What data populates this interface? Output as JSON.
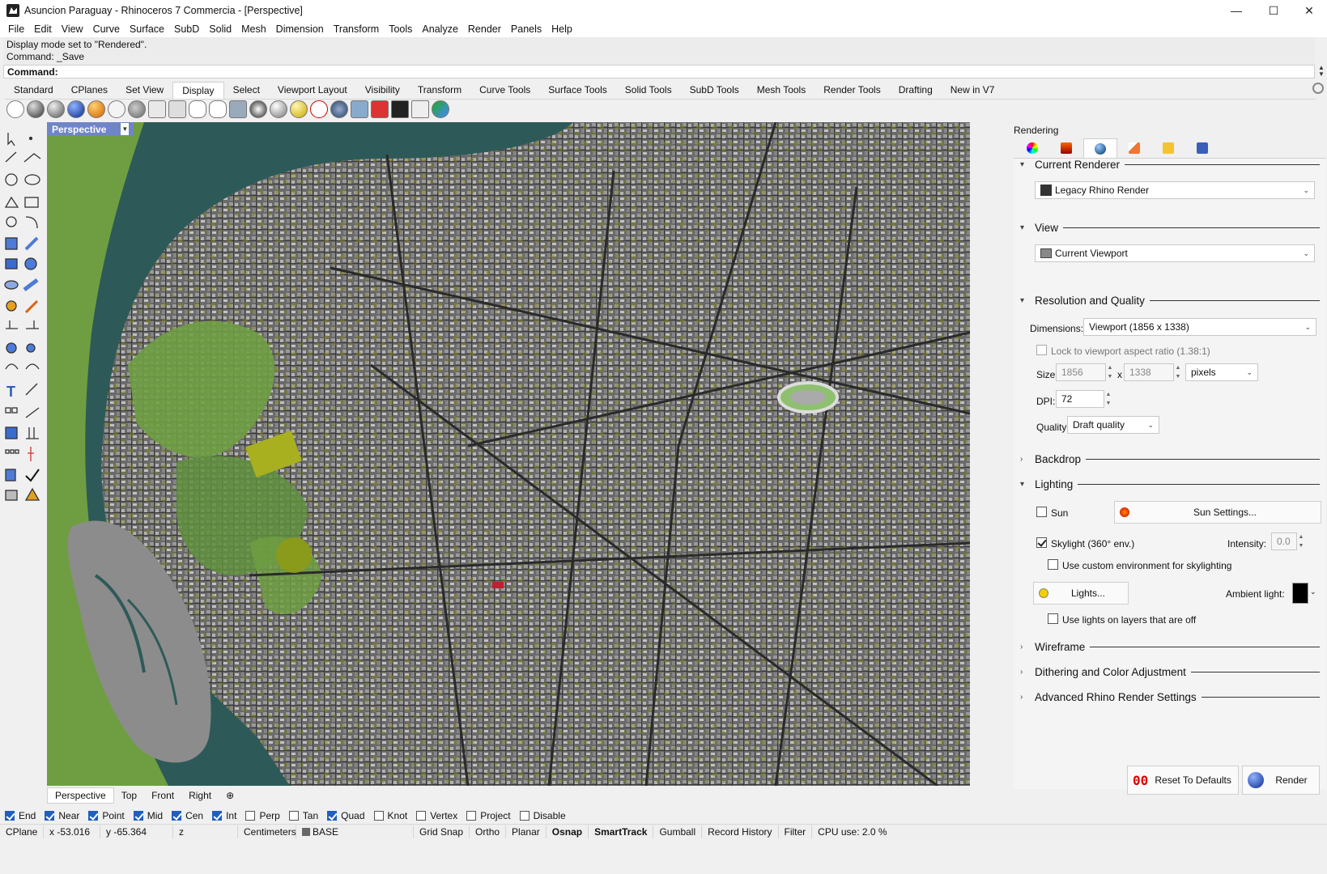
{
  "window": {
    "title": "Asuncion Paraguay - Rhinoceros 7 Commercia - [Perspective]",
    "minimize": "—",
    "maximize": "☐",
    "close": "✕"
  },
  "menu": [
    "File",
    "Edit",
    "View",
    "Curve",
    "Surface",
    "SubD",
    "Solid",
    "Mesh",
    "Dimension",
    "Transform",
    "Tools",
    "Analyze",
    "Render",
    "Panels",
    "Help"
  ],
  "command": {
    "history_1": "Display mode set to \"Rendered\".",
    "history_2": "Command: _Save",
    "prompt": "Command:"
  },
  "toolbar_tabs": [
    "Standard",
    "CPlanes",
    "Set View",
    "Display",
    "Select",
    "Viewport Layout",
    "Visibility",
    "Transform",
    "Curve Tools",
    "Surface Tools",
    "Solid Tools",
    "SubD Tools",
    "Mesh Tools",
    "Render Tools",
    "Drafting",
    "New in V7"
  ],
  "active_toolbar_tab": "Display",
  "viewport": {
    "name": "Perspective",
    "tabs": [
      "Perspective",
      "Top",
      "Front",
      "Right"
    ],
    "add_tab": "⊕"
  },
  "osnaps": [
    {
      "label": "End",
      "checked": true
    },
    {
      "label": "Near",
      "checked": true
    },
    {
      "label": "Point",
      "checked": true
    },
    {
      "label": "Mid",
      "checked": true
    },
    {
      "label": "Cen",
      "checked": true
    },
    {
      "label": "Int",
      "checked": true
    },
    {
      "label": "Perp",
      "checked": false
    },
    {
      "label": "Tan",
      "checked": false
    },
    {
      "label": "Quad",
      "checked": true
    },
    {
      "label": "Knot",
      "checked": false
    },
    {
      "label": "Vertex",
      "checked": false
    },
    {
      "label": "Project",
      "checked": false
    },
    {
      "label": "Disable",
      "checked": false
    }
  ],
  "status": {
    "cplane": "CPlane",
    "x": "x -53.016",
    "y": "y -65.364",
    "z": "z",
    "units": "Centimeters",
    "layer": "BASE",
    "grid_snap": "Grid Snap",
    "ortho": "Ortho",
    "planar": "Planar",
    "osnap": "Osnap",
    "smarttrack": "SmartTrack",
    "gumball": "Gumball",
    "record_history": "Record History",
    "filter": "Filter",
    "cpu": "CPU use: 2.0 %"
  },
  "rendering_panel": {
    "title": "Rendering",
    "current_renderer_header": "Current Renderer",
    "renderer": "Legacy Rhino Render",
    "view_header": "View",
    "view_value": "Current Viewport",
    "resolution_header": "Resolution and Quality",
    "dimensions_label": "Dimensions:",
    "dimensions_value": "Viewport (1856 x 1338)",
    "lock_aspect_label": "Lock to viewport aspect ratio (1.38:1)",
    "size_label": "Size:",
    "width": "1856",
    "x_sep": "x",
    "height": "1338",
    "size_units": "pixels",
    "dpi_label": "DPI:",
    "dpi": "72",
    "quality_label": "Quality:",
    "quality": "Draft quality",
    "backdrop_header": "Backdrop",
    "lighting_header": "Lighting",
    "sun_label": "Sun",
    "sun_settings": "Sun Settings...",
    "skylight_label": "Skylight (360° env.)",
    "intensity_label": "Intensity:",
    "intensity": "0.0",
    "custom_env_label": "Use custom environment for skylighting",
    "lights_button": "Lights...",
    "ambient_label": "Ambient light:",
    "lights_off_layers_label": "Use lights on layers that are off",
    "wireframe_header": "Wireframe",
    "dithering_header": "Dithering and Color Adjustment",
    "advanced_header": "Advanced Rhino Render Settings",
    "reset_button": "Reset To Defaults",
    "render_button": "Render"
  }
}
